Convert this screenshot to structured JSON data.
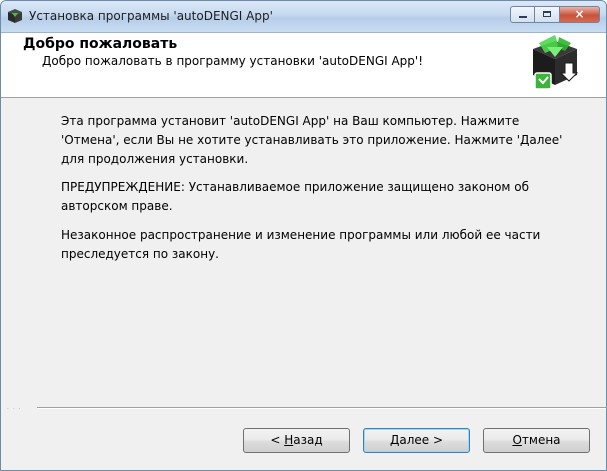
{
  "window": {
    "title": "Установка программы 'autoDENGI App'",
    "caption_min": "minimize",
    "caption_max": "maximize",
    "caption_close": "×"
  },
  "header": {
    "title": "Добро пожаловать",
    "subtitle": "Добро пожаловать в программу установки 'autoDENGI App'!",
    "logo_icon": "installer-box-icon"
  },
  "body": {
    "paragraph1": "Эта программа установит 'autoDENGI App' на Ваш компьютер. Нажмите 'Отмена', если Вы не хотите устанавливать это приложение. Нажмите 'Далее' для продолжения установки.",
    "paragraph2": "ПРЕДУПРЕЖДЕНИЕ: Устанавливаемое приложение защищено законом об авторском праве.",
    "paragraph3": "Незаконное распространение и изменение программы или любой ее части преследуется по закону."
  },
  "footer": {
    "separator_dots": "· · ·",
    "back": {
      "prefix": "< ",
      "hotkey": "Н",
      "rest": "азад"
    },
    "next": {
      "prefix": "",
      "hotkey": "Д",
      "rest": "алее >"
    },
    "cancel": {
      "prefix": "",
      "hotkey": "О",
      "rest": "тмена"
    }
  },
  "colors": {
    "titlebar": "#c5d9f0",
    "window_bg": "#f0f0f0",
    "header_bg": "#ffffff",
    "logo_green": "#3ab53a",
    "close_red": "#c9523b"
  }
}
